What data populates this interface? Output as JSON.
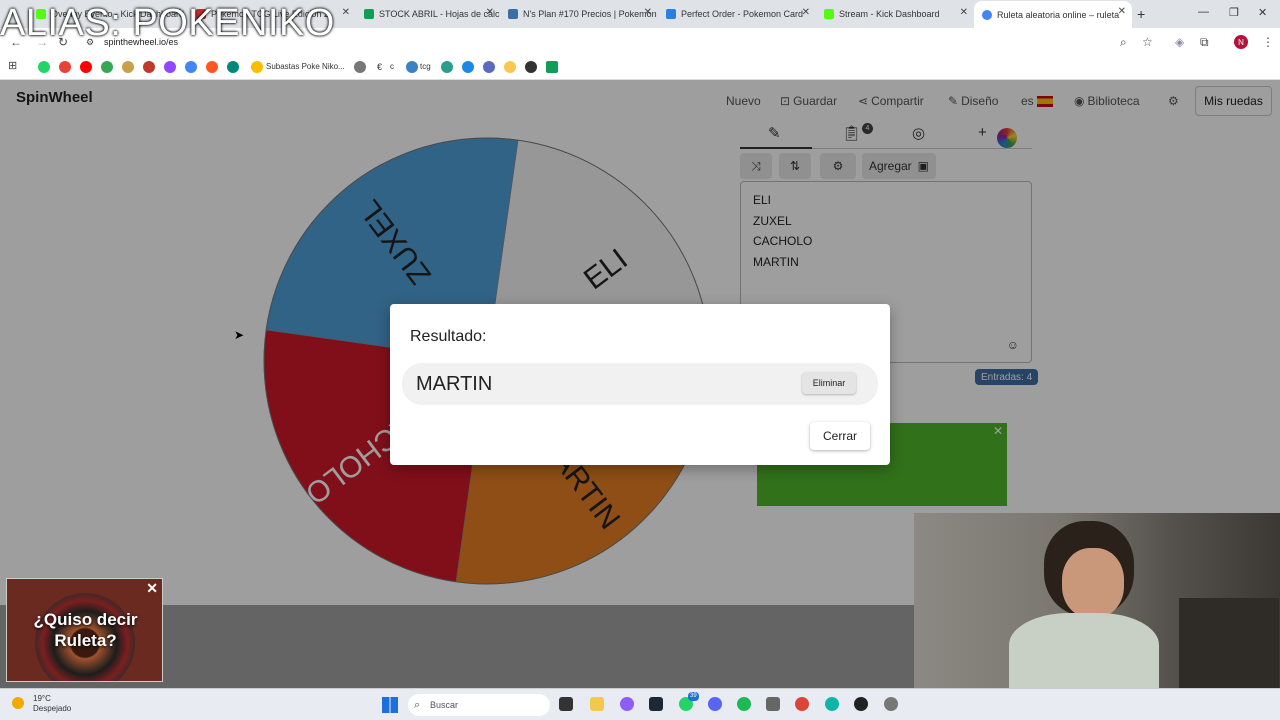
{
  "browser": {
    "tabs": [
      {
        "label": "Overlay Evento - Kick Dashboard",
        "color": "#53fc18"
      },
      {
        "label": "Pokemon TCG Live Edicion 2",
        "color": "#c92a2a"
      },
      {
        "label": "STOCK ABRIL - Hojas de cálculo",
        "color": "#0f9d58"
      },
      {
        "label": "N's Plan #170 Precios | Pokemon",
        "color": "#3b6ea5"
      },
      {
        "label": "Perfect Order - Pokemon Card",
        "color": "#2a7de1"
      },
      {
        "label": "Stream - Kick Dashboard",
        "color": "#53fc18"
      },
      {
        "label": "Ruleta aleatoria online – ruleta",
        "color": "#4285f4"
      }
    ],
    "url": "spinthewheel.io/es",
    "bookmark_label": "Subastas Poke Niko...",
    "bookmark_tcg": "tcg",
    "bookmark_c": "c"
  },
  "watermark": "ALIAS: POKENIKO",
  "app": {
    "logo": "SpinWheel",
    "nav": {
      "nuevo": "Nuevo",
      "guardar": "Guardar",
      "compartir": "Compartir",
      "diseno": "Diseño",
      "lang": "es",
      "biblioteca": "Biblioteca"
    },
    "mis_ruedas": "Mis ruedas",
    "agregar": "Agregar",
    "entries": [
      "ELI",
      "ZUXEL",
      "CACHOLO",
      "MARTIN"
    ],
    "entries_count": "Entradas: 4",
    "badge_count": "4",
    "wheel": {
      "slices": [
        {
          "label": "ELI",
          "color": "#f4f4f4",
          "text_color": "#222"
        },
        {
          "label": "MARTIN",
          "color": "#e67e22",
          "text_color": "#222"
        },
        {
          "label": "CACHOLO",
          "color": "#d0192b",
          "text_color": "#fff"
        },
        {
          "label": "ZUXEL",
          "color": "#4fa1d9",
          "text_color": "#222"
        }
      ]
    }
  },
  "modal": {
    "title": "Resultado:",
    "result": "MARTIN",
    "remove": "Eliminar",
    "close": "Cerrar"
  },
  "promo": {
    "line1": "¿Quiso decir",
    "line2": "Ruleta?"
  },
  "taskbar": {
    "temp": "19°C",
    "weather": "Despejado",
    "search": "Buscar",
    "discord_badge": "39"
  }
}
